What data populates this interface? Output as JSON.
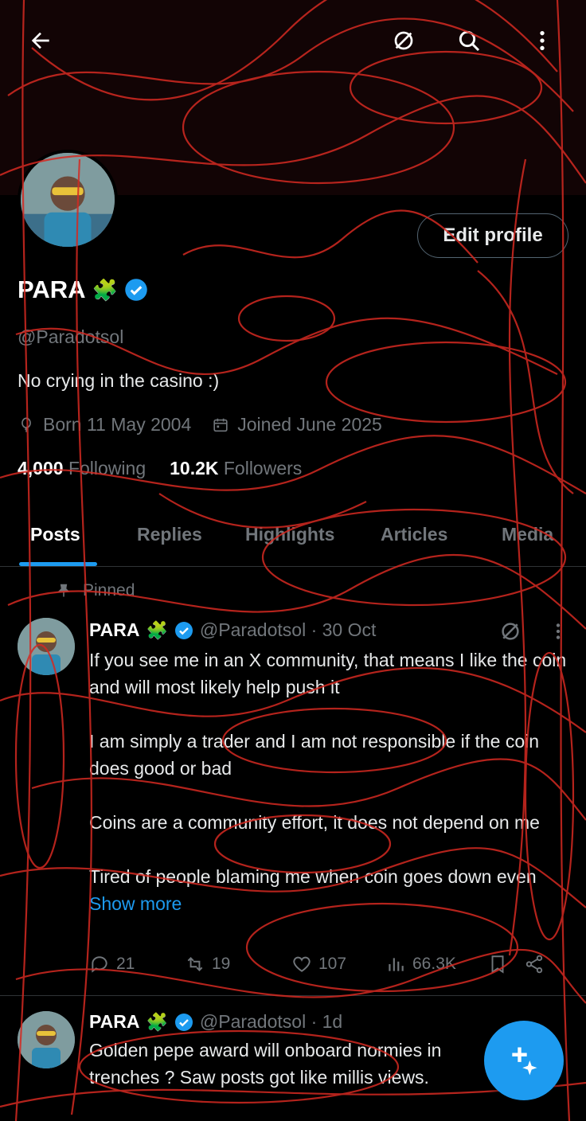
{
  "topbar": {
    "back_icon": "arrow-left-icon",
    "grok_icon": "grok-icon",
    "search_icon": "search-icon",
    "more_icon": "more-vertical-icon"
  },
  "profile": {
    "display_name": "PARA",
    "badge_emoji": "🧩",
    "handle": "@Paradotsol",
    "bio": "No crying in the casino :)",
    "born": "Born 11 May 2004",
    "joined": "Joined June 2025",
    "following_count": "4,000",
    "following_label": "Following",
    "followers_count": "10.2K",
    "followers_label": "Followers",
    "edit_label": "Edit profile"
  },
  "tabs": [
    {
      "label": "Posts"
    },
    {
      "label": "Replies"
    },
    {
      "label": "Highlights"
    },
    {
      "label": "Articles"
    },
    {
      "label": "Media"
    }
  ],
  "pinned_label": "Pinned",
  "posts": [
    {
      "name": "PARA",
      "handle_date": "@Paradotsol · 30 Oct",
      "paragraphs": [
        "If you see me in an X community, that means I like the coin and will most likely help push it",
        "I am simply a trader and I am not responsible if the coin does good or bad",
        "Coins are a community effort, it does not depend on me",
        "Tired of people blaming me when coin goes down even"
      ],
      "show_more": "Show more",
      "replies": "21",
      "reposts": "19",
      "likes": "107",
      "views": "66.3K"
    },
    {
      "name": "PARA",
      "handle_date": "@Paradotsol · 1d",
      "text": "Golden pepe award will onboard normies in trenches ? Saw posts got like millis views."
    }
  ],
  "colors": {
    "accent": "#1d9bf0",
    "scribble": "#d42a22",
    "muted": "#71767b"
  }
}
